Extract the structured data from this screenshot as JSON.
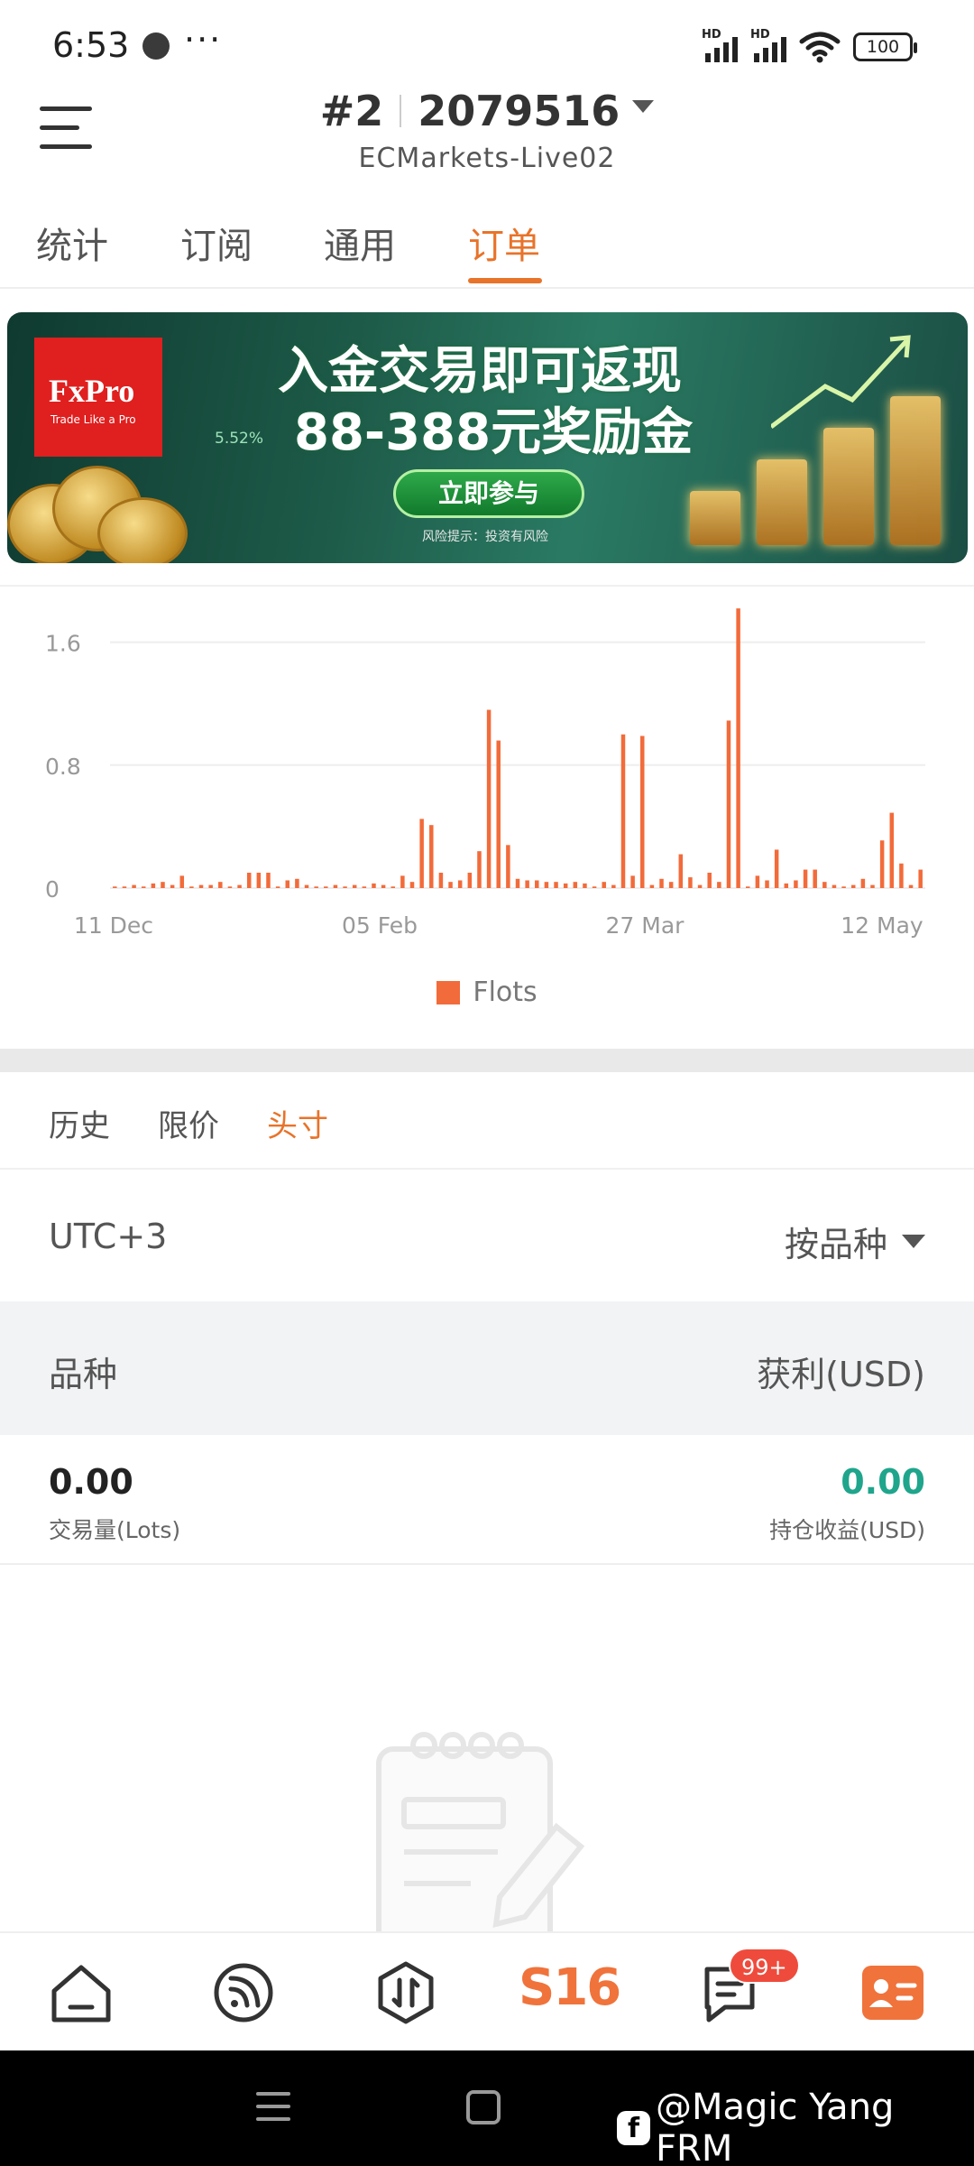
{
  "status": {
    "time": "6:53",
    "more": "···",
    "net1": "HD",
    "net2": "HD",
    "battery": "100"
  },
  "header": {
    "account_prefix": "#2",
    "account_number": "2079516",
    "server": "ECMarkets-Live02"
  },
  "top_tabs": [
    "统计",
    "订阅",
    "通用",
    "订单"
  ],
  "active_top_tab": "订单",
  "banner": {
    "logo_name": "FxPro",
    "logo_tagline": "Trade Like a Pro",
    "line1": "入金交易即可返现",
    "line2": "88-388元奖励金",
    "percent": "5.52%",
    "button": "立即参与",
    "risk": "风险提示：投资有风险"
  },
  "chart_data": {
    "type": "bar",
    "x_tick_labels": [
      "11 Dec",
      "05 Feb",
      "27 Mar",
      "12 May"
    ],
    "y_tick_labels": [
      "0",
      "0.8",
      "1.6"
    ],
    "ylim": [
      0,
      1.95
    ],
    "grid": true,
    "legend": [
      "Flots"
    ],
    "legend_position": "bottom",
    "color": "#f26b3a",
    "series": [
      {
        "name": "Flots",
        "values": [
          0.01,
          0.01,
          0.02,
          0.01,
          0.03,
          0.04,
          0.02,
          0.08,
          0.01,
          0.02,
          0.02,
          0.04,
          0.01,
          0.02,
          0.1,
          0.1,
          0.1,
          0.01,
          0.05,
          0.06,
          0.02,
          0.01,
          0.01,
          0.02,
          0.01,
          0.02,
          0.01,
          0.03,
          0.02,
          0.01,
          0.08,
          0.04,
          0.45,
          0.41,
          0.1,
          0.04,
          0.05,
          0.1,
          0.24,
          1.16,
          0.96,
          0.28,
          0.06,
          0.05,
          0.05,
          0.04,
          0.04,
          0.03,
          0.04,
          0.03,
          0.01,
          0.04,
          0.02,
          1.0,
          0.08,
          0.99,
          0.02,
          0.06,
          0.04,
          0.22,
          0.07,
          0.02,
          0.1,
          0.04,
          1.09,
          1.82,
          0.01,
          0.08,
          0.05,
          0.25,
          0.03,
          0.05,
          0.12,
          0.12,
          0.04,
          0.02,
          0.01,
          0.02,
          0.06,
          0.02,
          0.31,
          0.49,
          0.16,
          0.02,
          0.12
        ]
      }
    ]
  },
  "sub_tabs": [
    "历史",
    "限价",
    "头寸"
  ],
  "active_sub_tab": "头寸",
  "filter": {
    "timezone": "UTC+3",
    "sort_label": "按品种"
  },
  "table_head": {
    "left": "品种",
    "right": "获利(USD)"
  },
  "summary": {
    "volume_value": "0.00",
    "volume_label": "交易量(Lots)",
    "pnl_value": "0.00",
    "pnl_label": "持仓收益(USD)"
  },
  "bottom_nav": {
    "center_label": "S16",
    "badge": "99+"
  },
  "watermark": "@Magic Yang FRM"
}
